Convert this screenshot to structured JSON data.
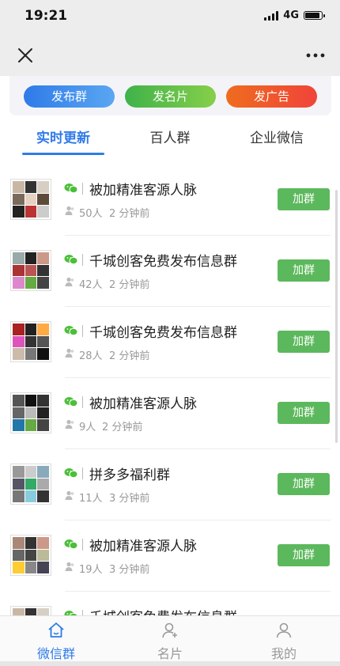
{
  "status_bar": {
    "time": "19:21",
    "network": "4G",
    "battery_level": 0.82
  },
  "actions": {
    "publish_group": "发布群",
    "publish_card": "发名片",
    "publish_ad": "发广告"
  },
  "colors": {
    "accent": "#2f7be8",
    "join_button": "#5cb85c",
    "muted_text": "#999999"
  },
  "tabs": [
    {
      "label": "实时更新",
      "active": true
    },
    {
      "label": "百人群",
      "active": false
    },
    {
      "label": "企业微信",
      "active": false
    }
  ],
  "groups": [
    {
      "title": "被加精准客源人脉",
      "count": "50人",
      "time": "2 分钟前",
      "join": "加群"
    },
    {
      "title": "千城创客免费发布信息群",
      "count": "42人",
      "time": "2 分钟前",
      "join": "加群"
    },
    {
      "title": "千城创客免费发布信息群",
      "count": "28人",
      "time": "2 分钟前",
      "join": "加群"
    },
    {
      "title": "被加精准客源人脉",
      "count": "9人",
      "time": "2 分钟前",
      "join": "加群"
    },
    {
      "title": "拼多多福利群",
      "count": "11人",
      "time": "3 分钟前",
      "join": "加群"
    },
    {
      "title": "被加精准客源人脉",
      "count": "19人",
      "time": "3 分钟前",
      "join": "加群"
    },
    {
      "title": "千城创客免费发布信息群",
      "count": "",
      "time": "",
      "join": ""
    }
  ],
  "bottom_tabs": [
    {
      "label": "微信群",
      "icon": "home-icon",
      "active": true
    },
    {
      "label": "名片",
      "icon": "person-add-icon",
      "active": false
    },
    {
      "label": "我的",
      "icon": "person-icon",
      "active": false
    }
  ]
}
